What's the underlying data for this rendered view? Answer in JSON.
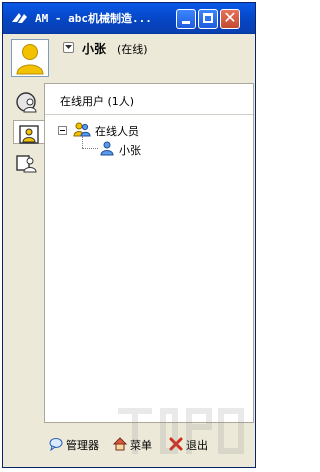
{
  "window": {
    "title": "AM - abc机械制造...",
    "minimize_icon": "minimize-icon",
    "maximize_icon": "maximize-icon",
    "close_icon": "close-icon"
  },
  "user": {
    "name": "小张",
    "status": "(在线)"
  },
  "side_tabs": [
    {
      "name": "contacts-tab",
      "icon": "globe-users-icon",
      "active": false
    },
    {
      "name": "online-users-tab",
      "icon": "user-card-icon",
      "active": true
    },
    {
      "name": "groups-tab",
      "icon": "group-card-icon",
      "active": false
    }
  ],
  "panel": {
    "header": "在线用户 (1人)",
    "tree": {
      "group_label": "在线人员",
      "members": [
        "小张"
      ]
    }
  },
  "bottom": {
    "manager": "管理器",
    "menu": "菜单",
    "exit": "退出"
  },
  "colors": {
    "titlebar": "#0a58e8",
    "window_bg": "#ece9d8",
    "close": "#d9593e"
  }
}
